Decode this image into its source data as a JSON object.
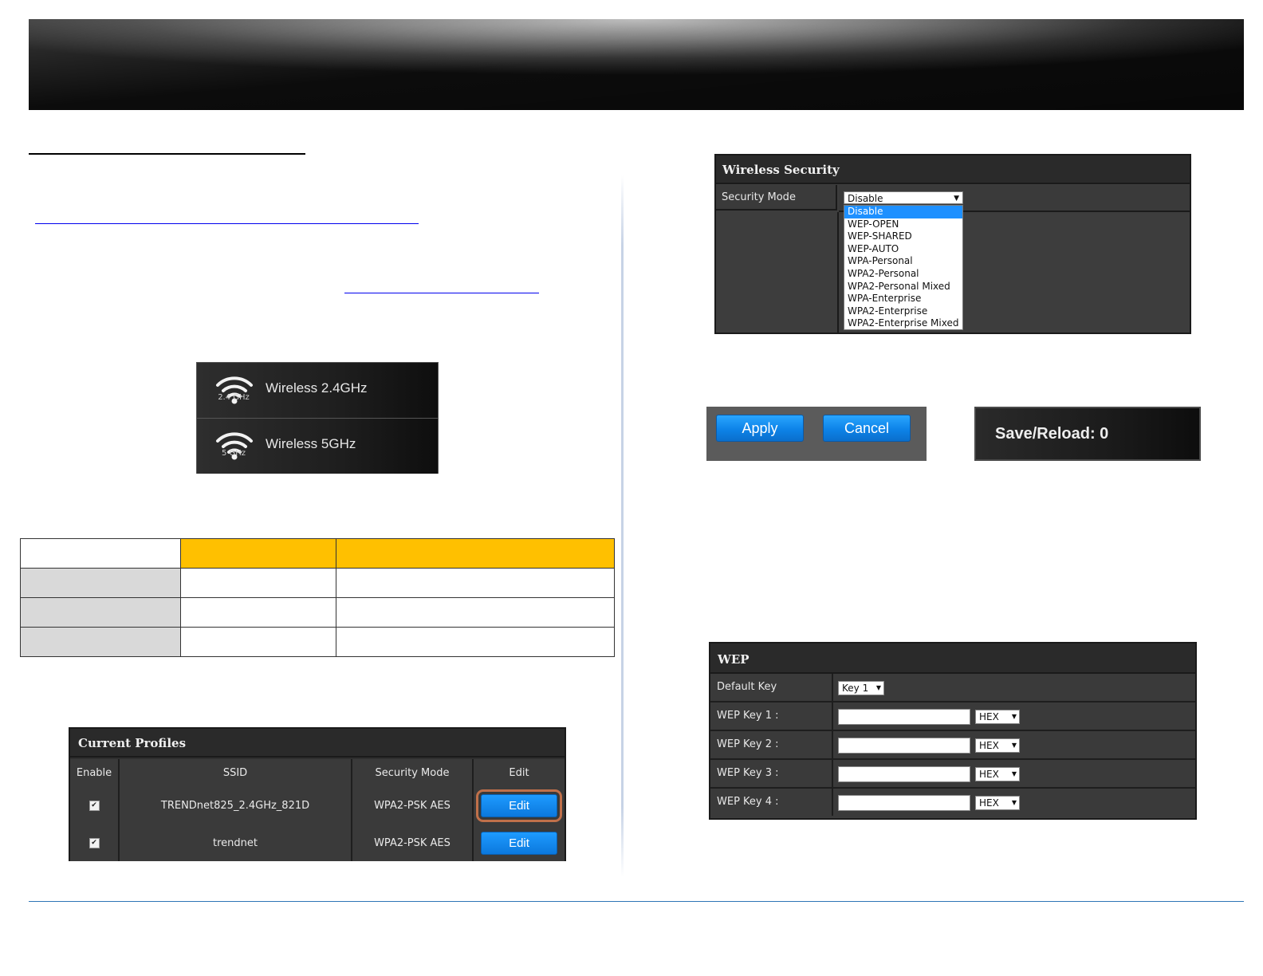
{
  "bands": [
    {
      "label": "Wireless 2.4GHz",
      "freq": "2.4 GHz",
      "icon": "wifi-icon"
    },
    {
      "label": "Wireless 5GHz",
      "freq": "5 GHz",
      "icon": "wifi-icon"
    }
  ],
  "profiles": {
    "title": "Current Profiles",
    "headers": [
      "Enable",
      "SSID",
      "Security Mode",
      "Edit"
    ],
    "rows": [
      {
        "enabled": "✔",
        "ssid": "TRENDnet825_2.4GHz_821D",
        "security": "WPA2-PSK AES",
        "edit": "Edit"
      },
      {
        "enabled": "✔",
        "ssid": "trendnet",
        "security": "WPA2-PSK AES",
        "edit": "Edit"
      }
    ]
  },
  "wireless_security": {
    "title": "Wireless Security",
    "label": "Security Mode",
    "selected": "Disable",
    "options": [
      "Disable",
      "WEP-OPEN",
      "WEP-SHARED",
      "WEP-AUTO",
      "WPA-Personal",
      "WPA2-Personal",
      "WPA2-Personal Mixed",
      "WPA-Enterprise",
      "WPA2-Enterprise",
      "WPA2-Enterprise Mixed"
    ]
  },
  "buttons": {
    "apply": "Apply",
    "cancel": "Cancel",
    "save_reload": "Save/Reload: 0"
  },
  "wep": {
    "title": "WEP",
    "default_key_label": "Default Key",
    "default_key_value": "Key 1",
    "keys": [
      {
        "label": "WEP Key 1 :",
        "format": "HEX"
      },
      {
        "label": "WEP Key 2 :",
        "format": "HEX"
      },
      {
        "label": "WEP Key 3 :",
        "format": "HEX"
      },
      {
        "label": "WEP Key 4 :",
        "format": "HEX"
      }
    ]
  },
  "colors": {
    "table_header": "#ffc000",
    "table_first_col": "#d9d9d9",
    "button_blue": "#0d83e8",
    "footer_line": "#2e75b6"
  }
}
